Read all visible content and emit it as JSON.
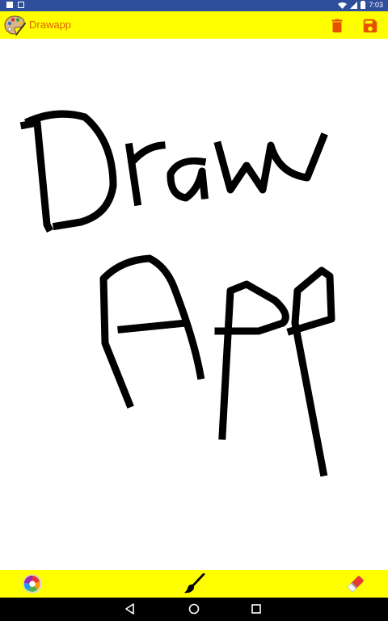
{
  "status_bar": {
    "time": "7:03"
  },
  "app_bar": {
    "title": "Drawapp",
    "icons": [
      "palette-logo-icon",
      "trash-icon",
      "save-icon"
    ]
  },
  "bottom_bar": {
    "icons": [
      "color-wheel-icon",
      "brush-icon",
      "eraser-icon"
    ]
  },
  "nav_bar": {
    "icons": [
      "back-icon",
      "home-icon",
      "recents-icon"
    ]
  },
  "colors": {
    "toolbar": "#ffff00",
    "title": "#e06000",
    "action_icon": "#e65100",
    "stroke": "#000000",
    "status_bar": "#2f4e9c"
  }
}
